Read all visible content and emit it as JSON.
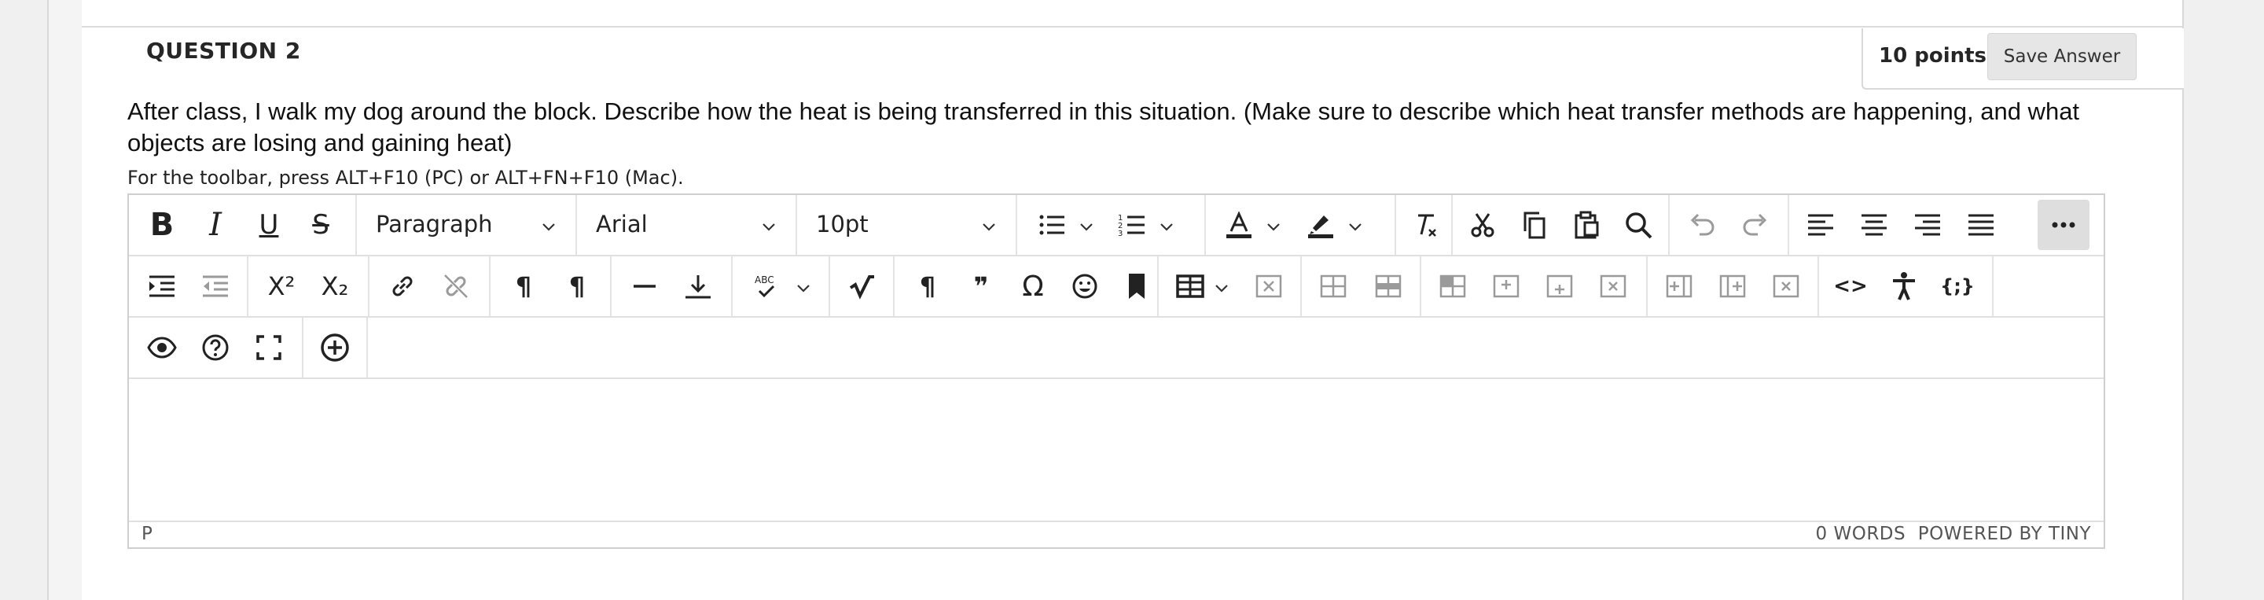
{
  "question": {
    "title": "QUESTION 2",
    "points": "10 points",
    "save_label": "Save Answer",
    "text": "After class, I walk my dog around the block. Describe how the heat is being transferred in this situation. (Make sure to describe which heat transfer methods are happening, and what objects are losing and gaining heat)"
  },
  "editor": {
    "hint": "For the toolbar, press ALT+F10 (PC) or ALT+FN+F10 (Mac).",
    "block_format": "Paragraph",
    "font_family": "Arial",
    "font_size": "10pt",
    "path": "P",
    "words": "0 WORDS",
    "powered_by": "POWERED BY TINY",
    "glyphs": {
      "bold": "B",
      "italic": "I",
      "underline": "U",
      "strike": "S",
      "pilcrow": "¶",
      "omega": "Ω",
      "quote": "❞",
      "code": "<>",
      "braces": "{;}",
      "superscript": "X²",
      "subscript": "X₂",
      "abc": "ABC"
    }
  },
  "colors": {
    "accent_gray": "#e6e6e6",
    "border": "#cfcfcf",
    "icon": "#222222"
  }
}
